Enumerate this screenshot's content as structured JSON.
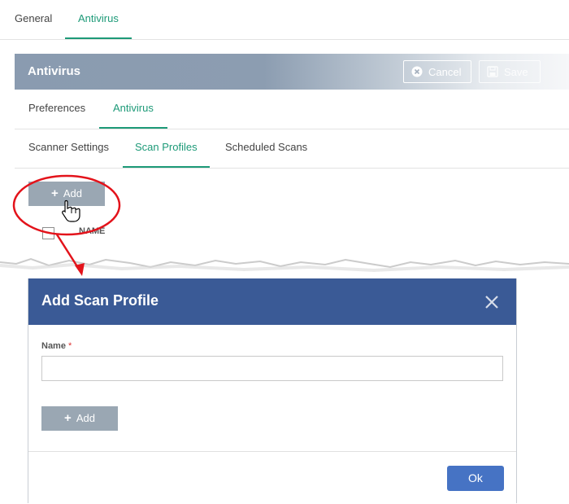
{
  "top_tabs": [
    {
      "label": "General",
      "active": false
    },
    {
      "label": "Antivirus",
      "active": true
    }
  ],
  "panel": {
    "title": "Antivirus",
    "cancel_label": "Cancel",
    "save_label": "Save",
    "sub_tabs": [
      {
        "label": "Preferences",
        "active": false
      },
      {
        "label": "Antivirus",
        "active": true
      }
    ],
    "sub_tabs2": [
      {
        "label": "Scanner Settings",
        "active": false
      },
      {
        "label": "Scan Profiles",
        "active": true
      },
      {
        "label": "Scheduled Scans",
        "active": false
      }
    ],
    "add_label": "Add",
    "name_column": "NAME"
  },
  "dialog": {
    "title": "Add Scan Profile",
    "name_label": "Name",
    "required_mark": "*",
    "name_value": "",
    "add_label": "Add",
    "ok_label": "Ok"
  },
  "icons": {
    "cancel": "cancel-circle-icon",
    "save": "save-floppy-icon",
    "close": "close-icon",
    "plus": "plus-icon",
    "cursor": "hand-pointer-icon"
  },
  "colors": {
    "accent_green": "#1d9a78",
    "dialog_header": "#3a5a96",
    "ok_button": "#4673c4",
    "annotation_red": "#e3131b"
  }
}
